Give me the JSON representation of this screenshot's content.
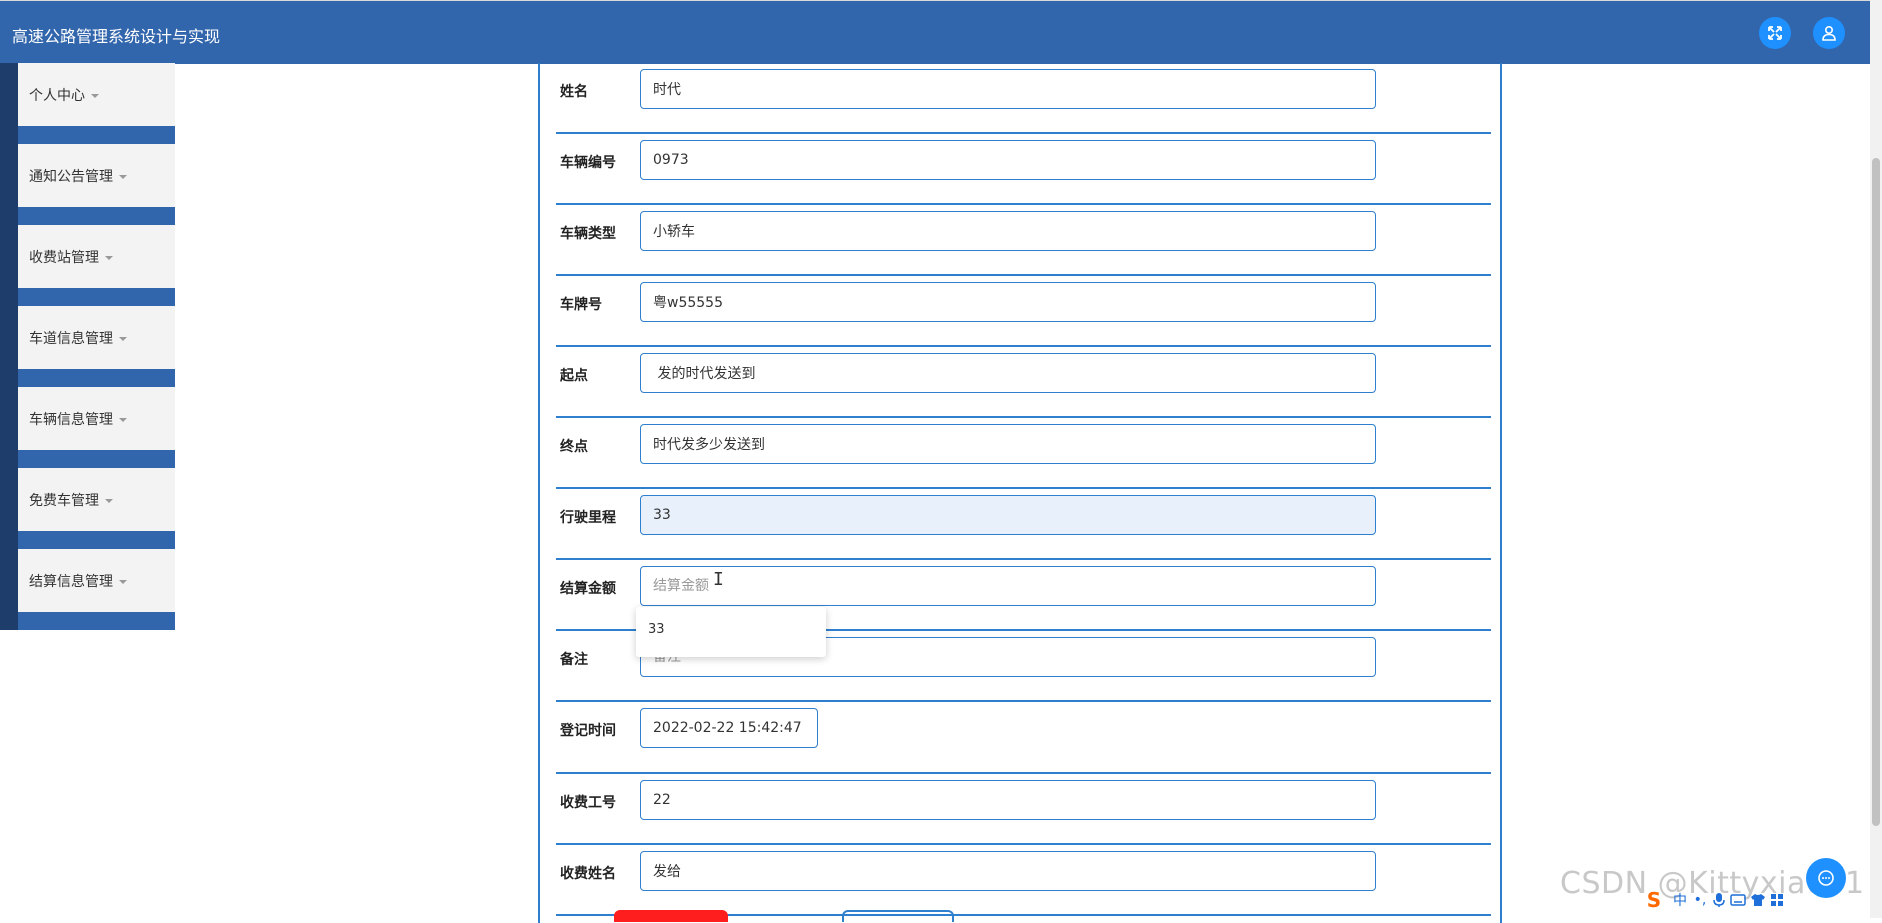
{
  "header": {
    "title": "高速公路管理系统设计与实现",
    "fullscreen_icon": "expand-icon",
    "user_icon": "user-icon"
  },
  "sidebar": {
    "items": [
      {
        "label": "个人中心"
      },
      {
        "label": "通知公告管理"
      },
      {
        "label": "收费站管理"
      },
      {
        "label": "车道信息管理"
      },
      {
        "label": "车辆信息管理"
      },
      {
        "label": "免费车管理"
      },
      {
        "label": "结算信息管理"
      }
    ]
  },
  "form": {
    "fields": [
      {
        "label": "姓名",
        "value": "时代",
        "placeholder": ""
      },
      {
        "label": "车辆编号",
        "value": "0973",
        "placeholder": ""
      },
      {
        "label": "车辆类型",
        "value": "小轿车",
        "placeholder": ""
      },
      {
        "label": "车牌号",
        "value": "粤w55555",
        "placeholder": ""
      },
      {
        "label": "起点",
        "value": " 发的时代发送到",
        "placeholder": ""
      },
      {
        "label": "终点",
        "value": "时代发多少发送到",
        "placeholder": ""
      },
      {
        "label": "行驶里程",
        "value": "33",
        "placeholder": ""
      },
      {
        "label": "结算金额",
        "value": "",
        "placeholder": "结算金额"
      },
      {
        "label": "备注",
        "value": "",
        "placeholder": "备注"
      },
      {
        "label": "登记时间",
        "value": "2022-02-22 15:42:47",
        "placeholder": ""
      },
      {
        "label": "收费工号",
        "value": "22",
        "placeholder": ""
      },
      {
        "label": "收费姓名",
        "value": "发给",
        "placeholder": ""
      }
    ],
    "autocomplete_option": "33"
  },
  "watermark": "CSDN @Kittyxia001",
  "ime": {
    "logo": "S",
    "mode": "中",
    "punct": "•,",
    "icons": [
      "mic-icon",
      "keyboard-icon",
      "shirt-icon",
      "grid-icon"
    ]
  },
  "colors": {
    "header": "#3266ac",
    "accent": "#2f7fcf",
    "sidebar_dark": "#1f3d6b",
    "danger": "#ff1e1e"
  }
}
